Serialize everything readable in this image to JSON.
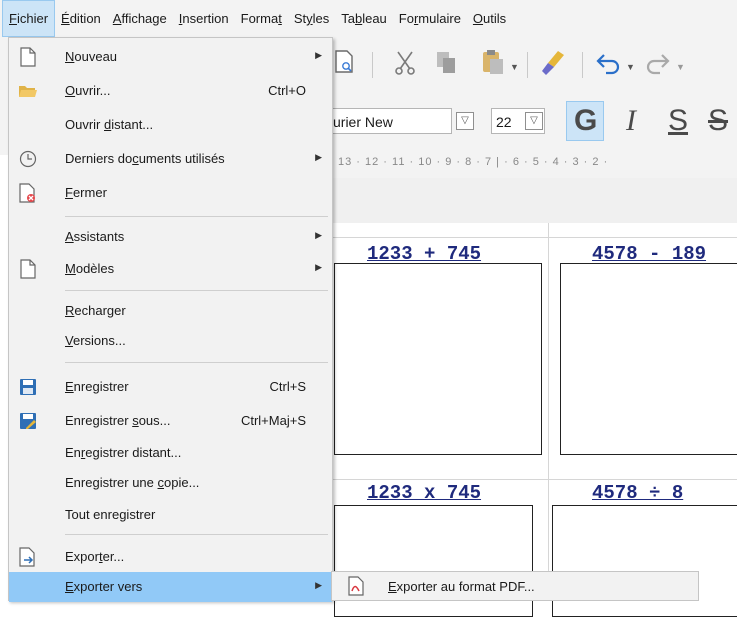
{
  "menubar": {
    "items": [
      {
        "label": "Fichier",
        "accel": "F",
        "active": true
      },
      {
        "label": "Édition",
        "accel": "É"
      },
      {
        "label": "Affichage",
        "accel": "A"
      },
      {
        "label": "Insertion",
        "accel": "I"
      },
      {
        "label": "Format",
        "accel": "t"
      },
      {
        "label": "Styles",
        "accel": "y"
      },
      {
        "label": "Tableau",
        "accel": "b"
      },
      {
        "label": "Formulaire",
        "accel": "r"
      },
      {
        "label": "Outils",
        "accel": "O"
      }
    ]
  },
  "toolbar": {
    "font_name": "urier New",
    "font_size": "22",
    "bold": "G",
    "italic": "I",
    "underline": "S",
    "strike": "S"
  },
  "ruler": {
    "text": "13 · 12 · 11 · 10 · 9 · 8 · 7 | · 6 · 5 · 4 · 3 · 2 ·"
  },
  "document": {
    "cells": [
      {
        "title": "1233 + 745"
      },
      {
        "title": "4578 - 189"
      },
      {
        "title": "1233 x 745"
      },
      {
        "title": "4578 ÷ 8"
      }
    ]
  },
  "menu": {
    "items": [
      {
        "label": "Nouveau",
        "u": "N",
        "submenu": true,
        "icon": "new-document-icon"
      },
      {
        "label": "Ouvrir...",
        "u": "O",
        "shortcut": "Ctrl+O",
        "icon": "open-folder-icon"
      },
      {
        "label": "Ouvrir distant...",
        "u": "d",
        "icon": ""
      },
      {
        "label": "Derniers documents utilisés",
        "u": "u",
        "submenu": true,
        "icon": "recent-clock-icon"
      },
      {
        "label": "Fermer",
        "u": "F",
        "icon": "close-document-icon"
      },
      {
        "label": "Assistants",
        "u": "A",
        "submenu": true,
        "icon": ""
      },
      {
        "label": "Modèles",
        "u": "M",
        "submenu": true,
        "icon": "template-document-icon"
      },
      {
        "label": "Recharger",
        "u": "R",
        "icon": ""
      },
      {
        "label": "Versions...",
        "u": "V",
        "icon": ""
      },
      {
        "label": "Enregistrer",
        "u": "E",
        "shortcut": "Ctrl+S",
        "icon": "save-icon"
      },
      {
        "label": "Enregistrer sous...",
        "u": "s",
        "shortcut": "Ctrl+Maj+S",
        "icon": "save-as-icon"
      },
      {
        "label": "Enregistrer distant...",
        "u": "r",
        "icon": ""
      },
      {
        "label": "Enregistrer une copie...",
        "u": "c",
        "icon": ""
      },
      {
        "label": "Tout enregistrer",
        "u": "",
        "icon": ""
      },
      {
        "label": "Exporter...",
        "u": "t",
        "icon": "export-icon"
      },
      {
        "label": "Exporter vers",
        "u": "E",
        "submenu": true,
        "highlighted": true,
        "icon": ""
      }
    ]
  },
  "submenu": {
    "label": "Exporter au format PDF...",
    "u": "E",
    "icon": "pdf-icon"
  },
  "colors": {
    "highlight": "#91c9f7",
    "menubar_active": "#cce4f7",
    "doc_title": "#1f2a7d"
  }
}
